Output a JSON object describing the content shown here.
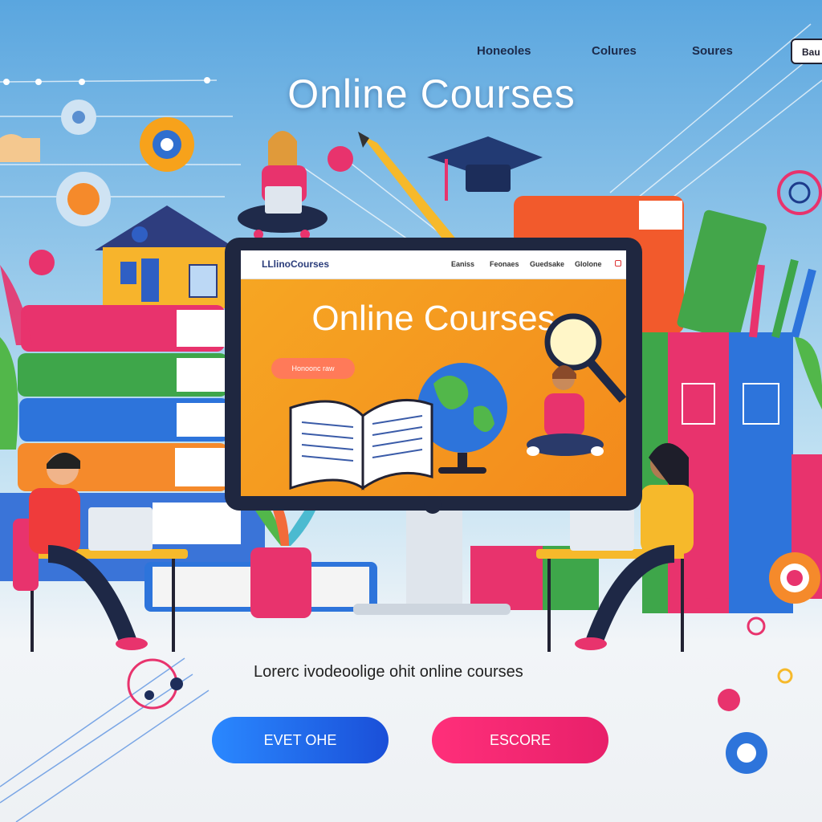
{
  "nav": {
    "links": [
      "Honeoles",
      "Colures",
      "Soures"
    ],
    "button_label": "Bau"
  },
  "hero": {
    "title": "Online Courses"
  },
  "monitor_screen": {
    "logo": "LLlinoCourses",
    "nav_links": [
      "Eaniss",
      "Feonaes",
      "Guedsake",
      "Glolone"
    ],
    "title": "Online Courses",
    "button_label": "Honoonc raw"
  },
  "tagline": "Lorerc ivodeoolige ohit online courses",
  "cta": {
    "primary_label": "EVET OHE",
    "secondary_label": "ESCORE"
  },
  "colors": {
    "bg_top": "#5ea8e0",
    "accent_blue": "#1a4fd8",
    "accent_pink": "#e8206a",
    "accent_orange": "#f6a623"
  }
}
